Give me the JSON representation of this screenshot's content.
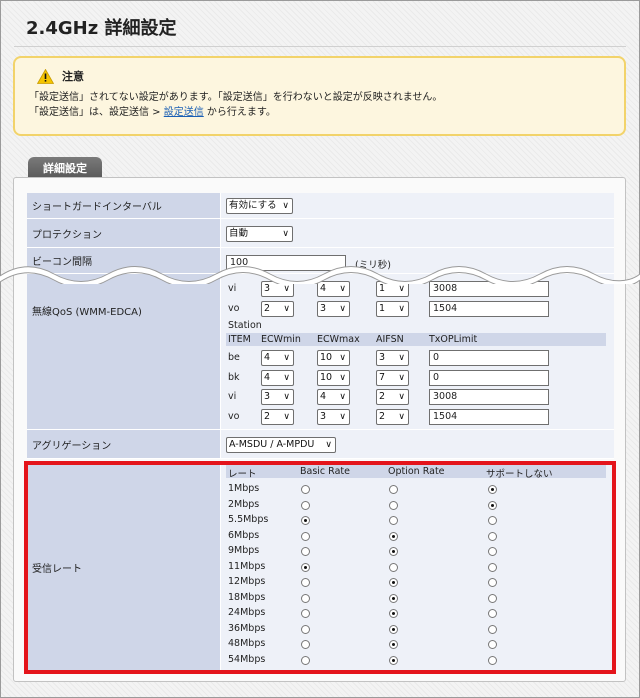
{
  "page": {
    "title": "2.4GHz 詳細設定"
  },
  "notice": {
    "heading": "注意",
    "line1": "「設定送信」されてない設定があります。「設定送信」を行わないと設定が反映されません。",
    "line2_prefix": "「設定送信」は、設定送信 > ",
    "line2_link": "設定送信",
    "line2_suffix": " から行えます。"
  },
  "tab": {
    "label": "詳細設定"
  },
  "guard_interval": {
    "label": "ショートガードインターバル",
    "value": "有効にする"
  },
  "protection": {
    "label": "プロテクション",
    "value": "自動"
  },
  "beacon": {
    "label": "ビーコン間隔",
    "value": "100",
    "unit": "(ミリ秒)"
  },
  "wmm": {
    "label": "無線QoS (WMM-EDCA)",
    "ap_rows": [
      {
        "item": "vi",
        "ecwmin": "3",
        "ecwmax": "4",
        "aifsn": "1",
        "txop": "3008"
      },
      {
        "item": "vo",
        "ecwmin": "2",
        "ecwmax": "3",
        "aifsn": "1",
        "txop": "1504"
      }
    ],
    "station_label": "Station",
    "columns": [
      "ITEM",
      "ECWmin",
      "ECWmax",
      "AIFSN",
      "TxOPLimit"
    ],
    "station_rows": [
      {
        "item": "be",
        "ecwmin": "4",
        "ecwmax": "10",
        "aifsn": "3",
        "txop": "0"
      },
      {
        "item": "bk",
        "ecwmin": "4",
        "ecwmax": "10",
        "aifsn": "7",
        "txop": "0"
      },
      {
        "item": "vi",
        "ecwmin": "3",
        "ecwmax": "4",
        "aifsn": "2",
        "txop": "3008"
      },
      {
        "item": "vo",
        "ecwmin": "2",
        "ecwmax": "3",
        "aifsn": "2",
        "txop": "1504"
      }
    ]
  },
  "aggregation": {
    "label": "アグリゲーション",
    "value": "A-MSDU / A-MPDU"
  },
  "rates": {
    "label": "受信レート",
    "columns": [
      "レート",
      "Basic Rate",
      "Option Rate",
      "サポートしない"
    ],
    "rows": [
      {
        "rate": "1Mbps",
        "selected": 2
      },
      {
        "rate": "2Mbps",
        "selected": 2
      },
      {
        "rate": "5.5Mbps",
        "selected": 0
      },
      {
        "rate": "6Mbps",
        "selected": 1
      },
      {
        "rate": "9Mbps",
        "selected": 1
      },
      {
        "rate": "11Mbps",
        "selected": 0
      },
      {
        "rate": "12Mbps",
        "selected": 1
      },
      {
        "rate": "18Mbps",
        "selected": 1
      },
      {
        "rate": "24Mbps",
        "selected": 1
      },
      {
        "rate": "36Mbps",
        "selected": 1
      },
      {
        "rate": "48Mbps",
        "selected": 1
      },
      {
        "rate": "54Mbps",
        "selected": 1
      }
    ]
  },
  "colors": {
    "highlight": "#e4141b",
    "label_bg": "#cfd6e8",
    "value_bg": "#eef1f8",
    "notice_border": "#f2d36a"
  }
}
